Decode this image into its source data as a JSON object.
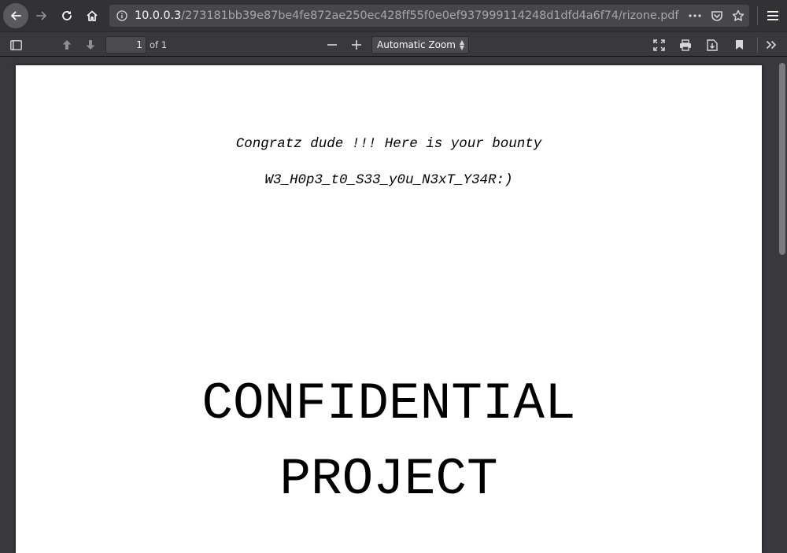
{
  "browser": {
    "url_host": "10.0.0.3",
    "url_path": "/273181bb39e87be4fe872ae250ec428ff55f0e0ef937999114248d1dfd4a6f74/rizone.pdf",
    "icons": [
      "back-arrow-icon",
      "forward-arrow-icon",
      "reload-icon",
      "home-icon",
      "info-icon",
      "more-dots-icon",
      "pocket-icon",
      "bookmark-star-icon",
      "hamburger-menu-icon"
    ]
  },
  "pdf_toolbar": {
    "page_number": "1",
    "page_count_label": "of 1",
    "zoom_label": "Automatic Zoom",
    "icons": [
      "sidebar-toggle-icon",
      "previous-page-icon",
      "next-page-icon",
      "zoom-out-icon",
      "zoom-in-icon",
      "presentation-mode-icon",
      "print-icon",
      "download-icon",
      "bookmark-icon",
      "tools-chevron-icon"
    ]
  },
  "document": {
    "line1": "Congratz dude !!! Here is your bounty",
    "line2": "W3_H0p3_t0_S33_y0u_N3xT_Y34R:)",
    "heading1": "CONFIDENTIAL",
    "heading2": "PROJECT"
  },
  "colors": {
    "toolbar_bg": "#323234",
    "urlbar_bg": "#474749",
    "viewer_bg": "#38383d",
    "page_bg": "#ffffff"
  }
}
